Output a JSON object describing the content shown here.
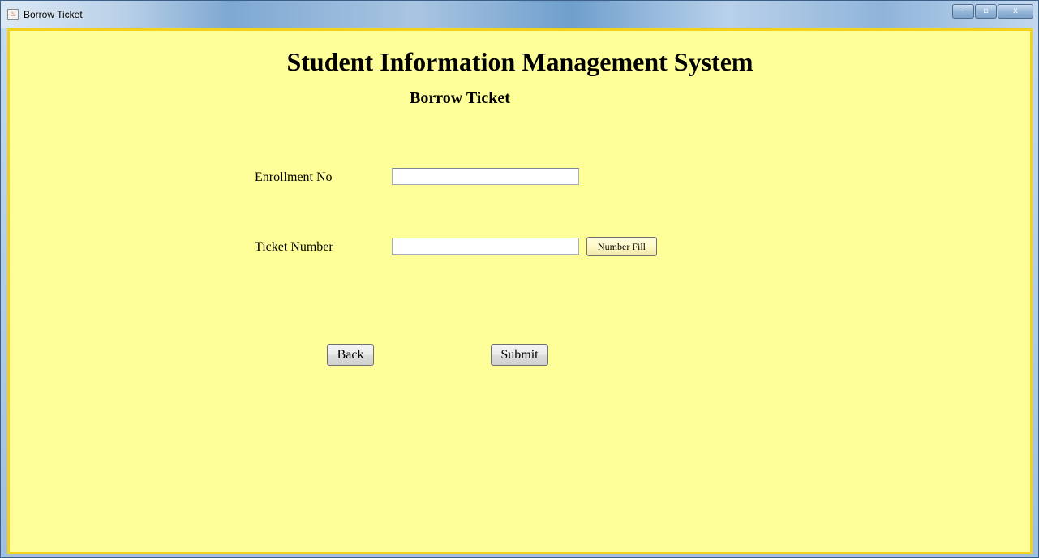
{
  "window": {
    "title": "Borrow Ticket",
    "controls": {
      "minimize_glyph": "–",
      "maximize_glyph": "▫",
      "close_glyph": "x"
    },
    "app_icon_glyph": "♨"
  },
  "form": {
    "title": "Student Information Management System",
    "subtitle": "Borrow Ticket",
    "enrollment": {
      "label": "Enrollment No",
      "value": ""
    },
    "ticket": {
      "label": "Ticket Number",
      "value": "",
      "fill_button_label": "Number Fill"
    },
    "back_label": "Back",
    "submit_label": "Submit"
  },
  "colors": {
    "background": "#ffff99",
    "border": "#f3d21f"
  }
}
